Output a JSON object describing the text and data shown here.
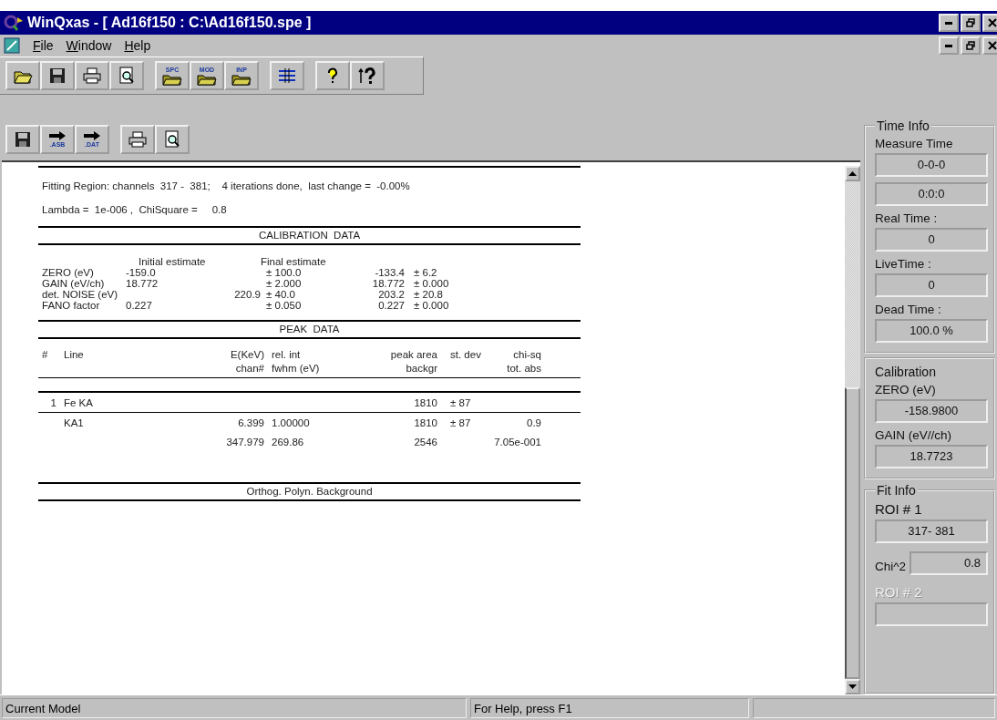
{
  "window": {
    "title": "WinQxas - [ Ad16f150 : C:\\Ad16f150.spe ]"
  },
  "menu": [
    {
      "label": "File"
    },
    {
      "label": "Window"
    },
    {
      "label": "Help"
    }
  ],
  "toolbar_1": [
    [
      {
        "kind": "open"
      },
      {
        "kind": "save"
      },
      {
        "kind": "print"
      },
      {
        "kind": "preview"
      }
    ],
    [
      {
        "kind": "folder",
        "tag": "SPC"
      },
      {
        "kind": "folder",
        "tag": "MOD"
      },
      {
        "kind": "folder",
        "tag": "INP"
      }
    ],
    [
      {
        "kind": "grid"
      }
    ],
    [
      {
        "kind": "help"
      },
      {
        "kind": "context-help"
      }
    ]
  ],
  "toolbar_2": [
    [
      {
        "kind": "save"
      },
      {
        "kind": "export",
        "tag": ".ASB"
      },
      {
        "kind": "export",
        "tag": ".DAT"
      }
    ],
    [
      {
        "kind": "print"
      },
      {
        "kind": "preview"
      }
    ]
  ],
  "report": {
    "fit_line": "Fitting Region: channels  317 -  381;    4 iterations done,  last change =  -0.00%",
    "lambda_line": "Lambda =  1e-006 ,  ChiSquare =     0.8",
    "calibration": {
      "heading": "CALIBRATION  DATA",
      "initial_header": "Initial estimate",
      "final_header": "Final estimate",
      "rows": [
        {
          "label": "ZERO (eV)",
          "initial": "-159.0",
          "final_range": "± 100.0",
          "value": "-133.4",
          "error": "± 6.2"
        },
        {
          "label": "GAIN (eV/ch)",
          "initial": "18.772",
          "final_range": "± 2.000",
          "value": "18.772",
          "error": "± 0.000"
        },
        {
          "label": "det. NOISE (eV)",
          "initial_noise": "220.9",
          "final_range": "± 40.0",
          "value": "203.2",
          "error": "± 20.8"
        },
        {
          "label": "FANO factor",
          "initial": "0.227",
          "final_range": "± 0.050",
          "value": "0.227",
          "error": "± 0.000"
        }
      ]
    },
    "peaks": {
      "heading": "PEAK  DATA",
      "columns": [
        {
          "top": "#"
        },
        {
          "top": "Line"
        },
        {
          "top": "E(KeV)",
          "bottom": "chan#"
        },
        {
          "top": "rel. int",
          "bottom": "fwhm (eV)"
        },
        {
          "top": "peak area",
          "bottom": "backgr"
        },
        {
          "top": "st. dev"
        },
        {
          "top": "chi-sq",
          "bottom": "tot. abs"
        }
      ],
      "rows": [
        {
          "kind": "group",
          "cells": [
            "1",
            "Fe KA",
            "",
            "",
            "1810",
            "± 87",
            ""
          ]
        },
        {
          "kind": "line",
          "cells": [
            "",
            "KA1",
            "6.399",
            "1.00000",
            "1810",
            "± 87",
            "0.9"
          ]
        },
        {
          "kind": "detail",
          "cells": [
            "",
            "",
            "347.979",
            "269.86",
            "2546",
            "",
            "7.05e-001"
          ]
        }
      ]
    },
    "background_heading": "Orthog. Polyn. Background"
  },
  "panel": {
    "time_info": {
      "title": "Time Info",
      "fields": [
        {
          "label": "Measure Time",
          "value": "0-0-0"
        },
        {
          "value": "0:0:0"
        },
        {
          "label": "Real Time :",
          "value": "0"
        },
        {
          "label": "LiveTime :",
          "value": "0"
        },
        {
          "label": "Dead Time :",
          "value": "100.0 %"
        }
      ]
    },
    "calibration": {
      "title": "Calibration",
      "fields": [
        {
          "label": "ZERO (eV)",
          "value": "-158.9800"
        },
        {
          "label": "GAIN (eV//ch)",
          "value": "18.7723"
        }
      ]
    },
    "fit_info": {
      "title": "Fit Info",
      "roi_1": {
        "label": "ROI # 1",
        "value": "317- 381",
        "disabled": false
      },
      "chi2": {
        "label": "Chi^2",
        "value": "0.8"
      },
      "roi_2": {
        "label": "ROI # 2",
        "disabled": true
      }
    }
  },
  "status_bar": [
    {
      "text": "Current Model"
    },
    {
      "text": "For Help, press F1"
    }
  ]
}
